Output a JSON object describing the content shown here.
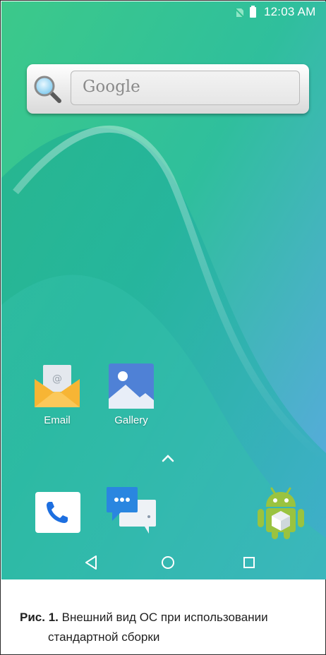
{
  "status_bar": {
    "time": "12:03 AM",
    "icons": [
      "no-sim-icon",
      "battery-icon"
    ]
  },
  "search": {
    "placeholder": "Google",
    "icon": "magnifier-icon"
  },
  "apps": [
    {
      "label": "Email",
      "icon": "email-icon"
    },
    {
      "label": "Gallery",
      "icon": "gallery-icon"
    }
  ],
  "app_drawer_icon": "chevron-up-icon",
  "dock": [
    {
      "icon": "phone-icon"
    },
    {
      "icon": "messaging-icon"
    },
    {
      "icon": "android-store-icon"
    }
  ],
  "nav": {
    "buttons": [
      "back-icon",
      "home-icon",
      "recents-icon"
    ]
  },
  "caption": {
    "figure_label": "Рис. 1.",
    "text_line1": "Внешний вид ОС при использовании",
    "text_line2": "стандартной сборки"
  },
  "colors": {
    "wallpaper_top": "#3fc48c",
    "wallpaper_bottom": "#63a9e6",
    "email_orange": "#f7b534",
    "gallery_blue": "#4f81d6",
    "phone_blue": "#1d6fe0",
    "android_green": "#9ac33f"
  }
}
